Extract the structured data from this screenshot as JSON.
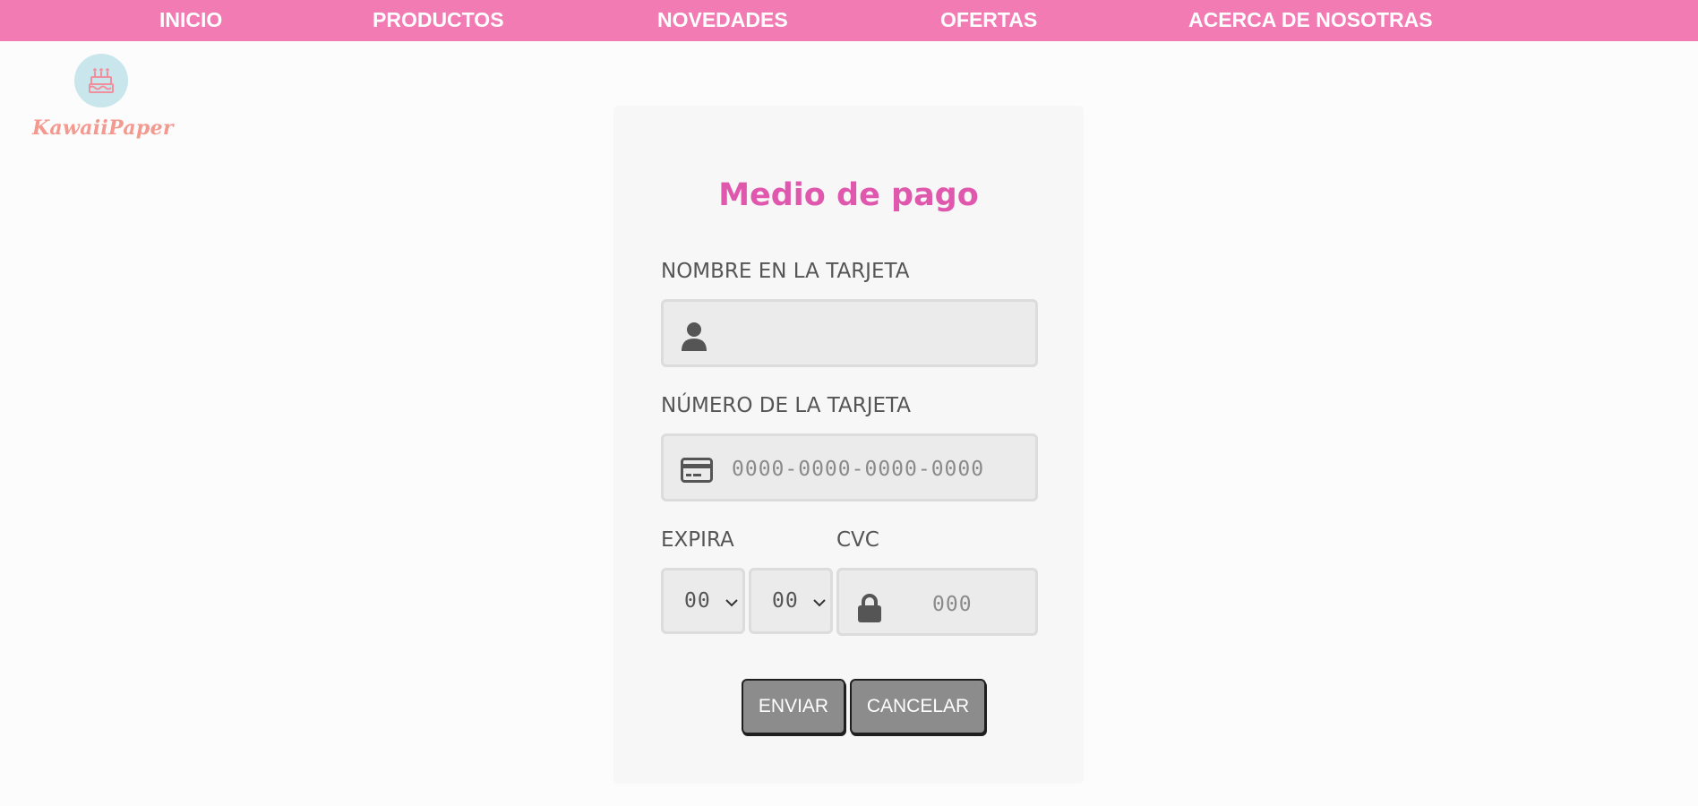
{
  "nav": {
    "items": [
      {
        "label": "INICIO"
      },
      {
        "label": "PRODUCTOS"
      },
      {
        "label": "NOVEDADES"
      },
      {
        "label": "OFERTAS"
      },
      {
        "label": "ACERCA DE NOSOTRAS"
      }
    ]
  },
  "brand": {
    "name": "KawaiiPaper",
    "icon": "cake-icon"
  },
  "form": {
    "title": "Medio de pago",
    "name_label": "NOMBRE EN LA TARJETA",
    "name_value": "",
    "number_label": "NÚMERO DE LA TARJETA",
    "number_placeholder": "0000-0000-0000-0000",
    "expiry_label": "EXPIRA",
    "expiry_month": "00",
    "expiry_year": "00",
    "cvc_label": "CVC",
    "cvc_placeholder": "000",
    "submit_label": "ENVIAR",
    "cancel_label": "CANCELAR"
  },
  "colors": {
    "nav_bg": "#f27bb3",
    "title": "#e058ad",
    "brand_text": "#f3998f",
    "button": "#8c8c8c"
  }
}
